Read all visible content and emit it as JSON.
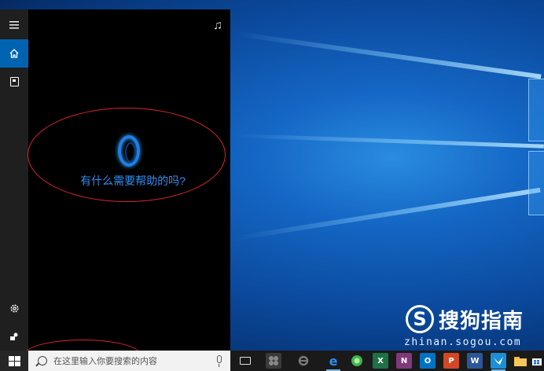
{
  "cortana": {
    "question": "有什么需要帮助的吗?",
    "rail": [
      {
        "name": "menu",
        "icon": "hamburger-icon"
      },
      {
        "name": "home",
        "icon": "home-icon",
        "active": true
      },
      {
        "name": "notebook",
        "icon": "notebook-icon"
      },
      {
        "name": "settings",
        "icon": "gear-icon"
      },
      {
        "name": "feedback",
        "icon": "feedback-icon"
      }
    ],
    "top_right_icon": "music-note-icon"
  },
  "taskbar": {
    "search_placeholder": "在这里输入你要搜索的内容",
    "apps": [
      {
        "name": "task-view",
        "icon": "task-view-icon"
      },
      {
        "name": "app-dim",
        "icon": "app-icon"
      },
      {
        "name": "ie",
        "icon": "internet-explorer-icon"
      },
      {
        "name": "edge",
        "icon": "edge-icon",
        "label": "e"
      },
      {
        "name": "green-app",
        "icon": "green-circle-icon"
      },
      {
        "name": "excel",
        "icon": "excel-icon",
        "label": "X"
      },
      {
        "name": "onenote",
        "icon": "onenote-icon",
        "label": "N"
      },
      {
        "name": "outlook",
        "icon": "outlook-icon",
        "label": "O"
      },
      {
        "name": "powerpoint",
        "icon": "powerpoint-icon",
        "label": "P"
      },
      {
        "name": "word",
        "icon": "word-icon",
        "label": "W"
      },
      {
        "name": "pinned-app",
        "icon": "bird-icon"
      },
      {
        "name": "file-explorer",
        "icon": "folder-icon"
      },
      {
        "name": "store",
        "icon": "store-icon"
      }
    ]
  },
  "watermark": {
    "logo_letter": "S",
    "name": "搜狗指南",
    "url": "zhinan.sogou.com"
  },
  "colors": {
    "accent": "#0063b1",
    "cortana_text": "#2e8ef0",
    "annotation": "#d7262c"
  }
}
